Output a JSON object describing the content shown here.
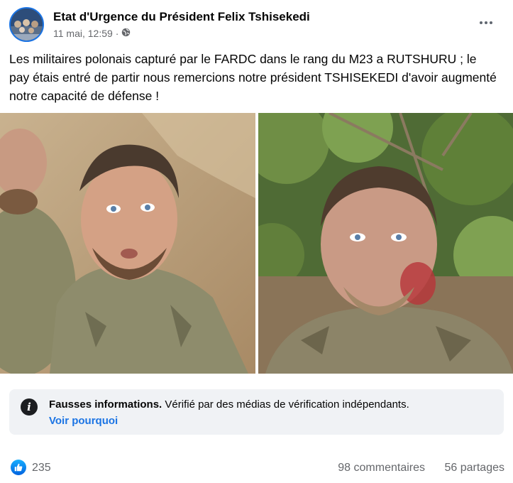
{
  "post": {
    "author": "Etat d'Urgence du Président Felix Tshisekedi",
    "timestamp": "11 mai, 12:59",
    "separator": "·",
    "audience_icon": "globe-icon",
    "more_icon": "more-options-icon",
    "text": "Les militaires polonais capturé par le FARDC dans le rang du M23 a RUTSHURU ; le pay étais  entré de partir nous remercions notre président TSHISEKEDI d'avoir augmenté notre capacité de défense !"
  },
  "fact_check": {
    "icon": "info-icon",
    "title": "Fausses informations.",
    "description": "Vérifié par des médias de vérification indépendants.",
    "link": "Voir pourquoi"
  },
  "engagement": {
    "like_icon": "thumbs-up-icon",
    "likes": "235",
    "comments": "98 commentaires",
    "shares": "56 partages"
  },
  "colors": {
    "link": "#1b74e4",
    "secondary_text": "#65676b",
    "fact_box_bg": "#f0f2f5"
  }
}
